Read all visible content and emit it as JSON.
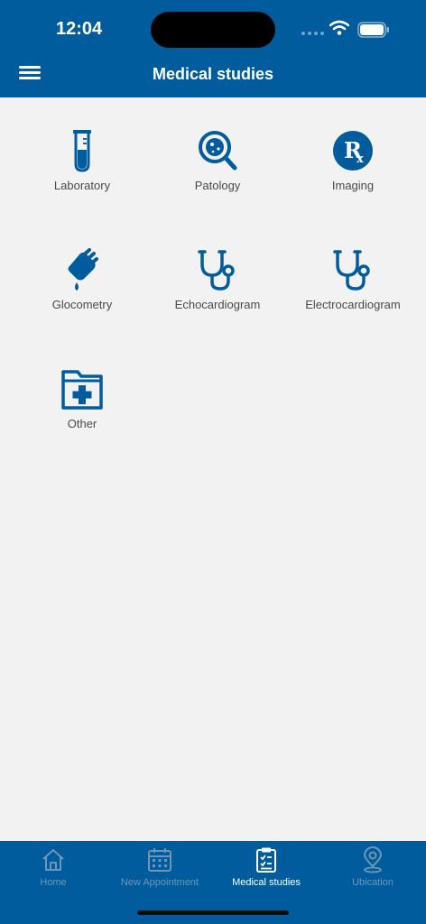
{
  "status_bar": {
    "time": "12:04"
  },
  "header": {
    "title": "Medical studies"
  },
  "studies": [
    {
      "label": "Laboratory",
      "icon": "test-tube-icon"
    },
    {
      "label": "Patology",
      "icon": "magnifier-cell-icon"
    },
    {
      "label": "Imaging",
      "icon": "rx-icon"
    },
    {
      "label": "Glocometry",
      "icon": "finger-drop-icon"
    },
    {
      "label": "Echocardiogram",
      "icon": "stethoscope-icon"
    },
    {
      "label": "Electrocardiogram",
      "icon": "stethoscope-icon"
    },
    {
      "label": "Other",
      "icon": "medical-folder-icon"
    }
  ],
  "bottom_nav": [
    {
      "label": "Home",
      "icon": "home-icon",
      "active": false
    },
    {
      "label": "New Appointment",
      "icon": "calendar-icon",
      "active": false
    },
    {
      "label": "Medical studies",
      "icon": "clipboard-icon",
      "active": true
    },
    {
      "label": "Ubication",
      "icon": "location-pin-icon",
      "active": false
    }
  ],
  "colors": {
    "primary": "#005c9c",
    "background": "#f2f2f2",
    "inactive_nav": "#6f96b7",
    "label_text": "#4a4a4a"
  }
}
